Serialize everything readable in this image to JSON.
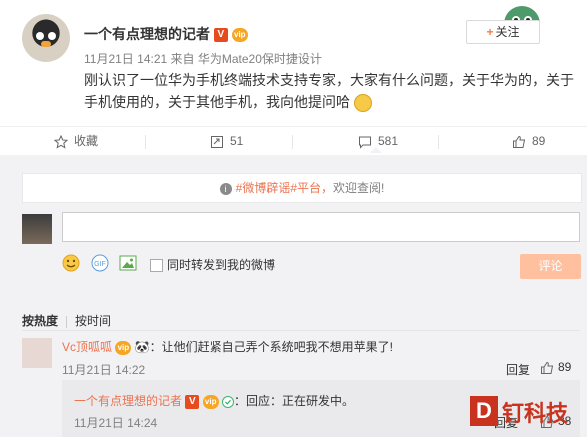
{
  "post": {
    "author": "一个有点理想的记者",
    "verified_badge": "V",
    "vip_badge": "vip",
    "date": "11月21日 14:21",
    "source_prefix": "来自",
    "source": "华为Mate20保时捷设计",
    "text": "刚认识了一位华为手机终端技术支持专家，大家有什么问题，关于华为的，关于手机使用的，关于其他手机，我向他提问哈",
    "follow_label": "关注",
    "follow_plus": "+"
  },
  "actions": {
    "favorite": "收藏",
    "repost": "51",
    "comment": "581",
    "like": "89"
  },
  "notice": {
    "text_red": "#微博辟谣#平台，",
    "text_gray": "欢迎查阅!"
  },
  "composer": {
    "repost_label": "同时转发到我的微博",
    "submit_label": "评论",
    "input_value": ""
  },
  "sort": {
    "hot": "按热度",
    "time": "按时间"
  },
  "comments": [
    {
      "author": "Vc顶呱呱",
      "text": "：让他们赶紧自己弄个系统吧我不想用苹果了!",
      "time": "11月21日 14:22",
      "reply": "回复",
      "likes": "89",
      "subreply": {
        "author": "一个有点理想的记者",
        "text": "：回应：正在研发中。",
        "time": "11月21日 14:24",
        "reply": "回复",
        "likes": "38"
      }
    }
  ],
  "watermark": {
    "letter": "D",
    "text": "钉科技"
  },
  "colors": {
    "accent": "#fa7d3c",
    "link": "#eb7350",
    "submit_bg": "#ffc09f"
  }
}
